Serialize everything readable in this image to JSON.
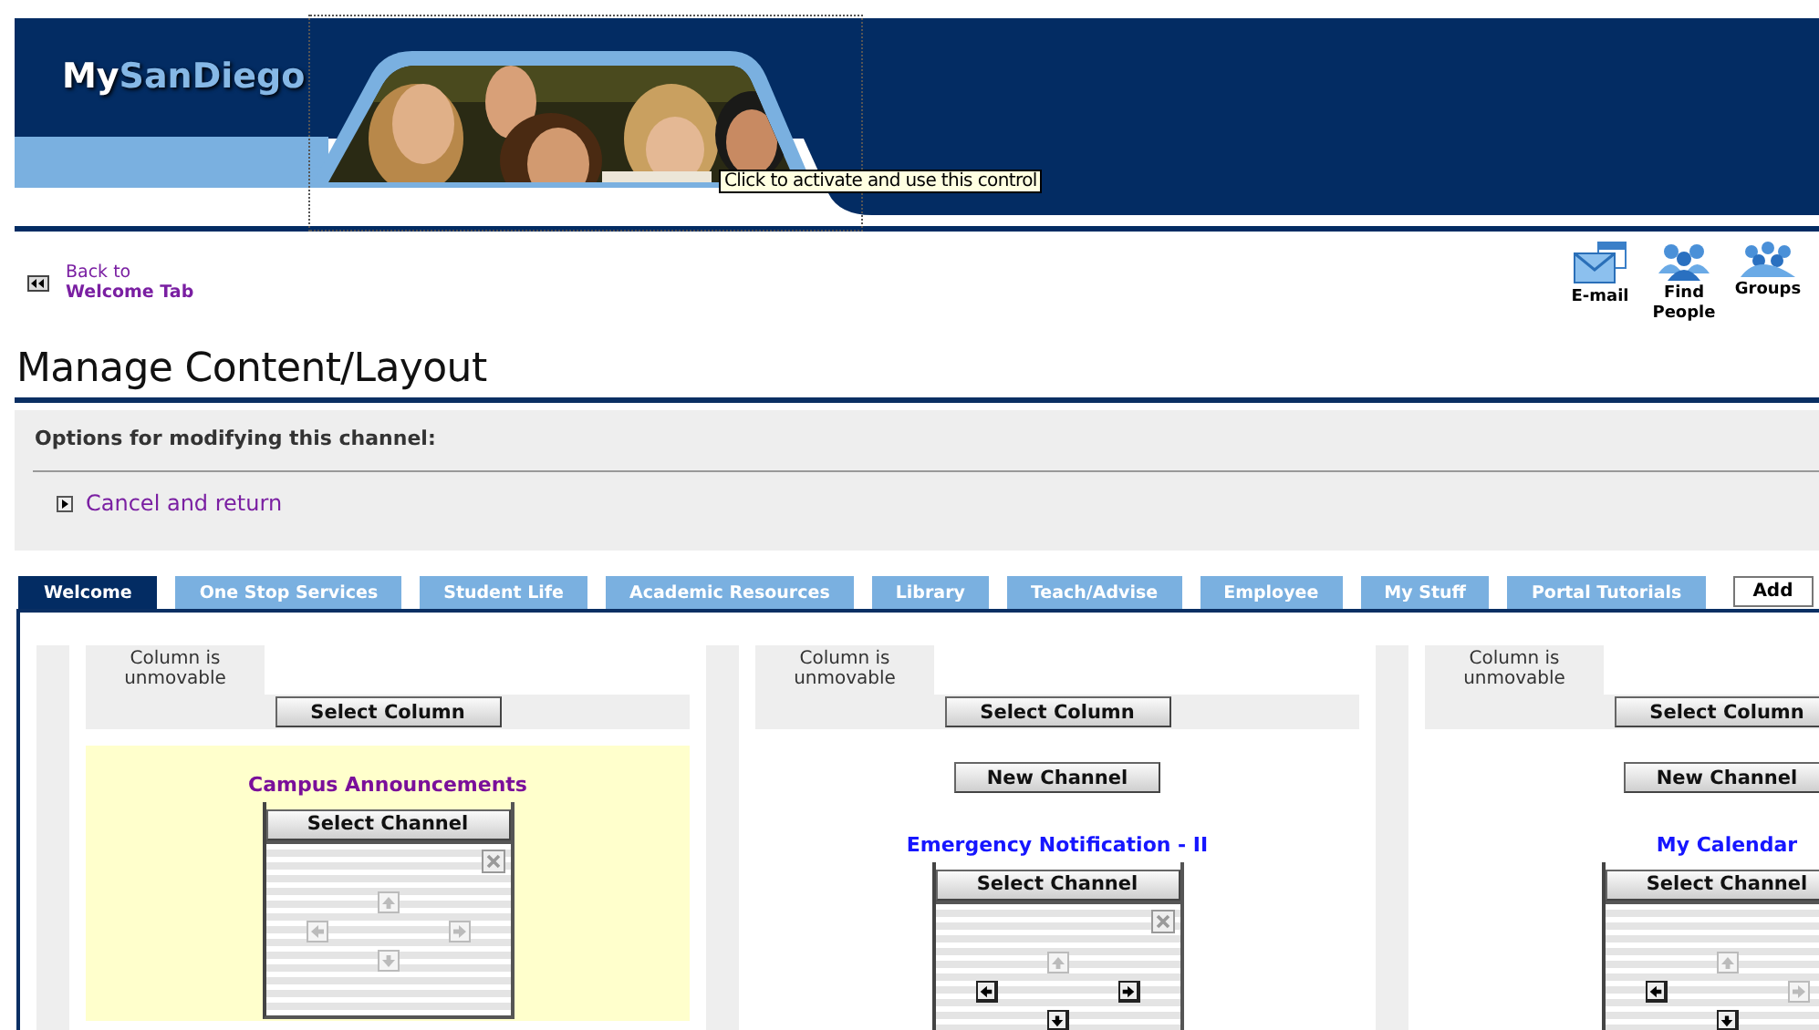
{
  "banner": {
    "logo": [
      "My",
      "SanDiego"
    ],
    "tooltip": "Click to activate and use this control",
    "focused": true
  },
  "back_link": {
    "line_1": "Back to",
    "line_2": "Welcome Tab"
  },
  "quick_links": [
    {
      "kind": "email",
      "label": "E-mail"
    },
    {
      "kind": "people",
      "label": "Find People"
    },
    {
      "kind": "groups",
      "label": "Groups"
    }
  ],
  "page_title": "Manage Content/Layout",
  "options": {
    "heading": "Options for modifying this channel:",
    "links": [
      "Cancel and return"
    ]
  },
  "tabs": [
    {
      "label": "Welcome",
      "selected": true
    },
    {
      "label": "One Stop Services",
      "selected": false
    },
    {
      "label": "Student Life",
      "selected": false
    },
    {
      "label": "Academic Resources",
      "selected": false
    },
    {
      "label": "Library",
      "selected": false
    },
    {
      "label": "Teach/Advise",
      "selected": false
    },
    {
      "label": "Employee",
      "selected": false
    },
    {
      "label": "My Stuff",
      "selected": false
    },
    {
      "label": "Portal Tutorials",
      "selected": false
    }
  ],
  "add_button": "Add",
  "columns": [
    {
      "status": "Column is unmovable",
      "select_label": "Select Column",
      "channels": [
        {
          "title": "Campus Announcements",
          "selected": true,
          "select_label": "Select Channel",
          "close": true,
          "moves": {
            "up": {
              "enabled": false
            },
            "left": {
              "enabled": false
            },
            "right": {
              "enabled": false
            },
            "down": {
              "enabled": false
            }
          }
        }
      ]
    },
    {
      "status": "Column is unmovable",
      "select_label": "Select Column",
      "new_channel": "New Channel",
      "channels": [
        {
          "title": "Emergency Notification - II",
          "selected": false,
          "select_label": "Select Channel",
          "close": true,
          "moves": {
            "up": {
              "enabled": false
            },
            "left": {
              "enabled": true
            },
            "right": {
              "enabled": true
            },
            "down": {
              "enabled": true
            }
          }
        }
      ]
    },
    {
      "status": "Column is unmovable",
      "select_label": "Select Column",
      "new_channel": "New Channel",
      "channels": [
        {
          "title": "My Calendar",
          "selected": false,
          "select_label": "Select Channel",
          "moves": {
            "up": {
              "enabled": false
            },
            "left": {
              "enabled": true
            },
            "right": {
              "enabled": false
            },
            "down": {
              "enabled": true
            }
          }
        }
      ]
    }
  ]
}
